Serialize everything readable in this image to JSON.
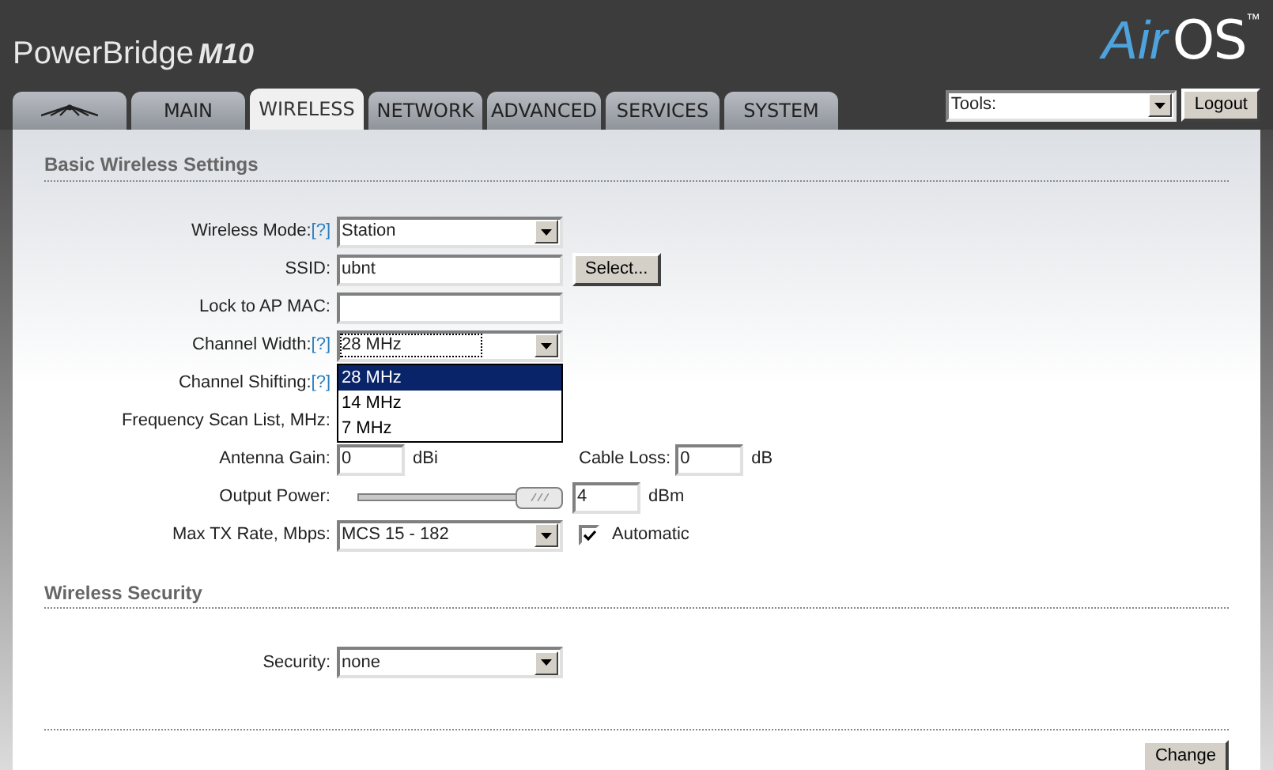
{
  "header": {
    "product": "PowerBridge",
    "model": "M10",
    "brand_air": "Air",
    "brand_os": "OS",
    "trademark": "™"
  },
  "tabs": [
    {
      "kind": "logo",
      "selected": false
    },
    {
      "kind": "text",
      "label": "MAIN",
      "selected": false
    },
    {
      "kind": "text",
      "label": "WIRELESS",
      "selected": true
    },
    {
      "kind": "text",
      "label": "NETWORK",
      "selected": false
    },
    {
      "kind": "text",
      "label": "ADVANCED",
      "selected": false
    },
    {
      "kind": "text",
      "label": "SERVICES",
      "selected": false
    },
    {
      "kind": "text",
      "label": "SYSTEM",
      "selected": false
    }
  ],
  "tools": {
    "value": "Tools:"
  },
  "logout": "Logout",
  "sections": [
    {
      "title": "Basic Wireless Settings",
      "rows": [
        {
          "kind": "select",
          "label": "Wireless Mode:",
          "help": "[?]",
          "value": "Station"
        },
        {
          "kind": "input",
          "label": "SSID:",
          "value": "ubnt",
          "button": "Select..."
        },
        {
          "kind": "input",
          "label": "Lock to AP MAC:"
        },
        {
          "kind": "select",
          "label": "Channel Width:",
          "help": "[?]",
          "value": "28 MHz",
          "expanded": true,
          "options": [
            {
              "label": "28 MHz",
              "selected": true
            },
            {
              "label": "14 MHz",
              "selected": false
            },
            {
              "label": "7 MHz",
              "selected": false
            }
          ]
        },
        {
          "kind": "label",
          "label": "Channel Shifting:",
          "help": "[?]"
        },
        {
          "kind": "label",
          "label": "Frequency Scan List, MHz:"
        },
        {
          "kind": "pair",
          "label": "Antenna Gain:",
          "value": "0",
          "unit": "dBi",
          "label2": "Cable Loss:",
          "value2": "0",
          "unit2": "dB"
        },
        {
          "kind": "slider",
          "label": "Output Power:",
          "level": 1,
          "value": "4",
          "unit": "dBm"
        },
        {
          "kind": "select",
          "label": "Max TX Rate, Mbps:",
          "value": "MCS 15 - 182",
          "checkbox": {
            "label": "Automatic",
            "checked": true
          }
        }
      ]
    },
    {
      "title": "Wireless Security",
      "rows": [
        {
          "kind": "select",
          "label": "Security:",
          "value": "none"
        }
      ]
    }
  ],
  "change_button": "Change"
}
